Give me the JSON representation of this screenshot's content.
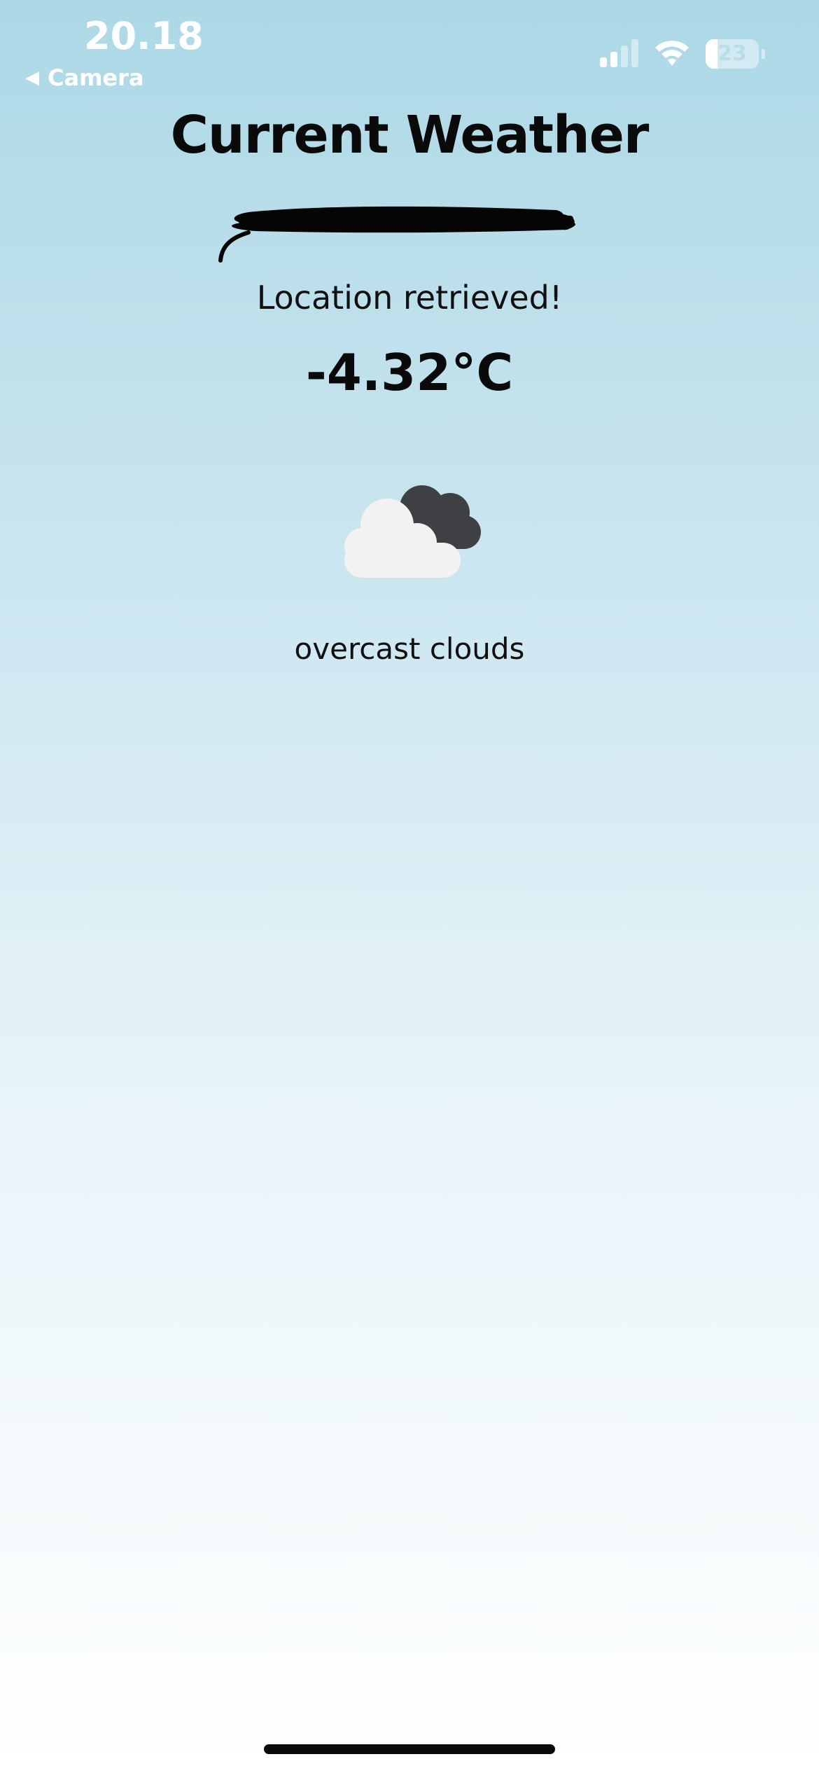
{
  "status_bar": {
    "time": "20.18",
    "back_label": "Camera",
    "back_chevron": "◀",
    "signal_icon": "cellular-signal-icon",
    "wifi_icon": "wifi-icon",
    "battery_level": "23",
    "battery_fraction": 0.23
  },
  "main": {
    "title": "Current Weather",
    "location_status": "Location retrieved!",
    "temperature": "-4.32°C",
    "condition_icon": "overcast-clouds-icon",
    "description": "overcast clouds"
  },
  "colors": {
    "background_top": "#acd8e6",
    "background_bottom": "#ffffff",
    "text": "#0a0a0a"
  }
}
